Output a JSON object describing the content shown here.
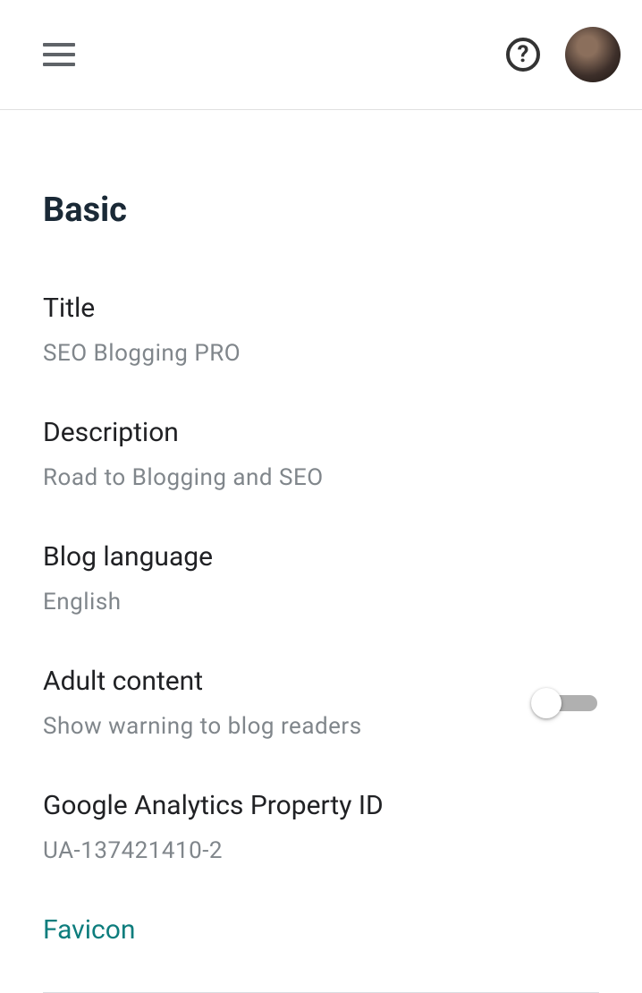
{
  "section": {
    "heading": "Basic"
  },
  "settings": {
    "title": {
      "label": "Title",
      "value": "SEO Blogging PRO"
    },
    "description": {
      "label": "Description",
      "value": "Road to Blogging and SEO"
    },
    "language": {
      "label": "Blog language",
      "value": "English"
    },
    "adult": {
      "label": "Adult content",
      "value": "Show warning to blog readers",
      "enabled": false
    },
    "analytics": {
      "label": "Google Analytics Property ID",
      "value": "UA-137421410-2"
    },
    "favicon": {
      "label": "Favicon"
    }
  }
}
